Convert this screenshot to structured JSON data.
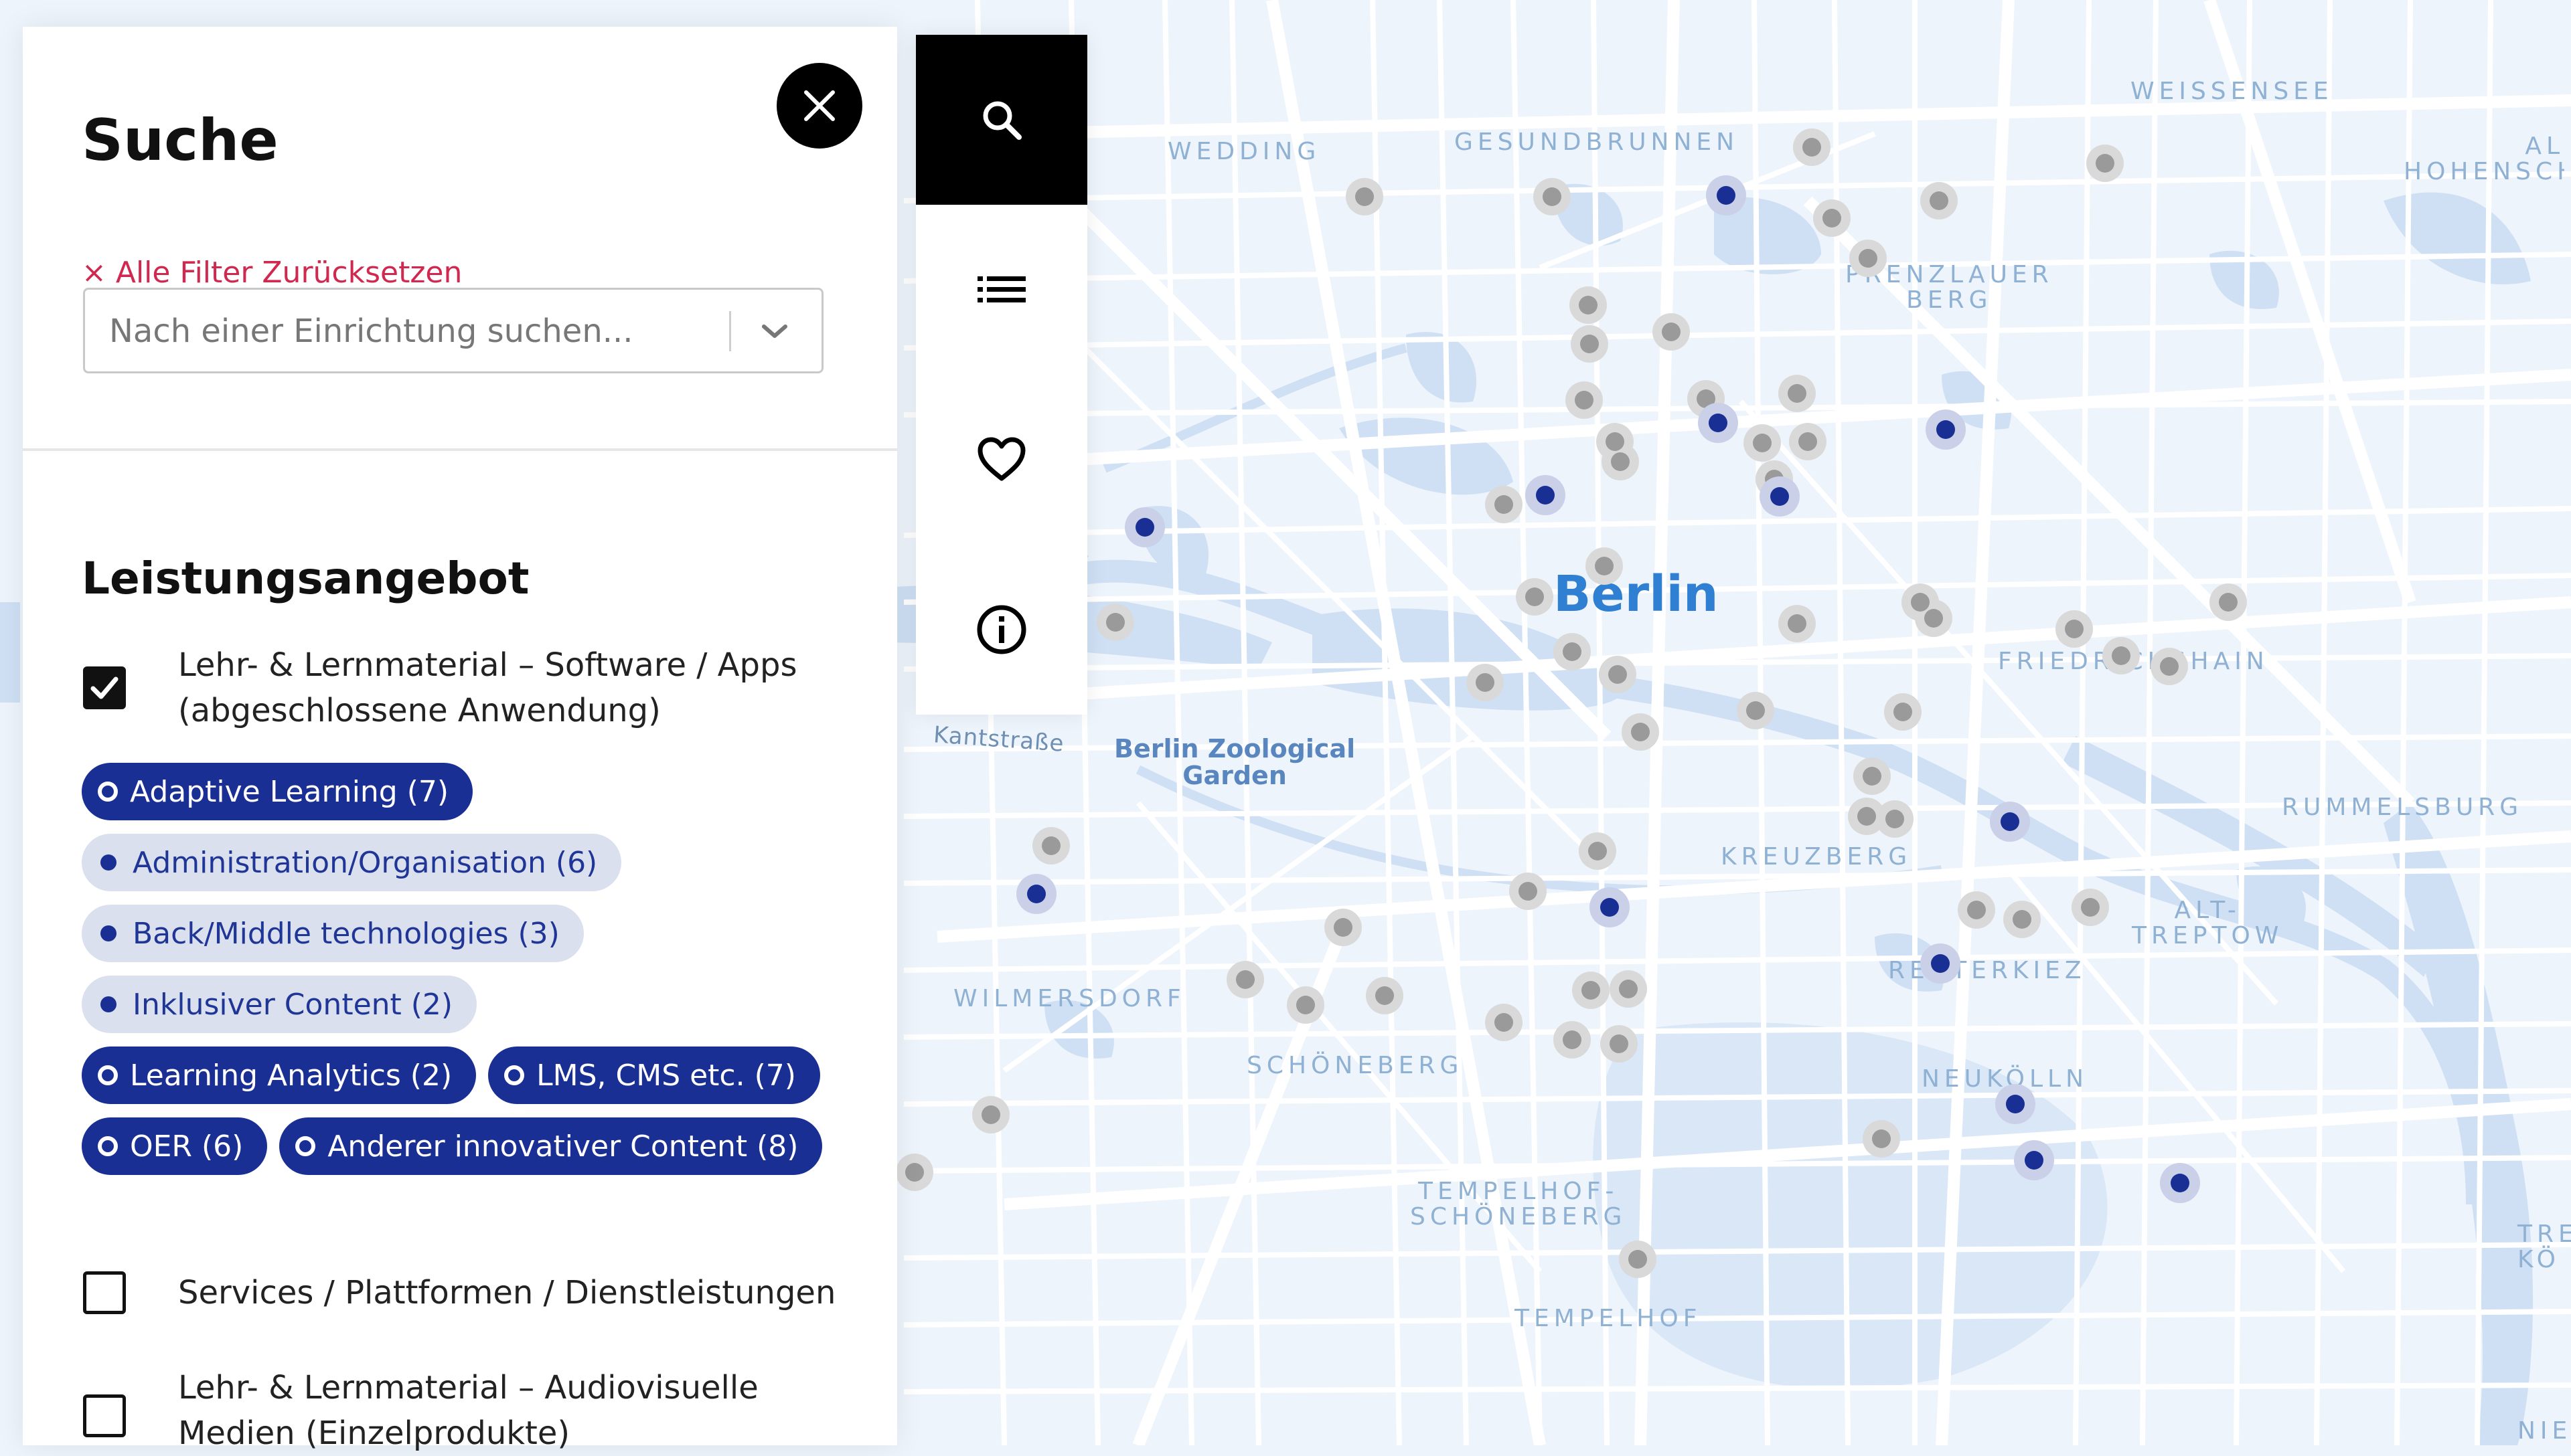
{
  "panel": {
    "title": "Suche",
    "reset_label": "× Alle Filter Zurücksetzen",
    "search": {
      "placeholder": "Nach einer Einrichtung suchen...",
      "value": ""
    },
    "section_title": "Leistungsangebot",
    "categories": [
      {
        "label": "Lehr- & Lernmaterial – Software / Apps (abgeschlossene Anwendung)",
        "checked": true
      },
      {
        "label": "Services / Plattformen / Dienstleistungen",
        "checked": false
      },
      {
        "label": "Lehr- & Lernmaterial – Audiovisuelle Medien (Einzelprodukte)",
        "checked": false
      }
    ],
    "chips": [
      {
        "label": "Adaptive Learning (7)",
        "active": true
      },
      {
        "label": "Administration/Organisation (6)",
        "active": false
      },
      {
        "label": "Back/Middle technologies (3)",
        "active": false
      },
      {
        "label": "Inklusiver Content (2)",
        "active": false
      },
      {
        "label": "Learning Analytics (2)",
        "active": true
      },
      {
        "label": "LMS, CMS etc. (7)",
        "active": true
      },
      {
        "label": "OER (6)",
        "active": true
      },
      {
        "label": "Anderer innovativer Content (8)",
        "active": true
      }
    ]
  },
  "nav": [
    {
      "icon": "search-icon",
      "active": true
    },
    {
      "icon": "list-icon",
      "active": false
    },
    {
      "icon": "heart-icon",
      "active": false
    },
    {
      "icon": "info-icon",
      "active": false
    }
  ],
  "map": {
    "city_label": "Berlin",
    "districts": {
      "wedding": "WEDDING",
      "gesundbrunnen": "GESUNDBRUNNEN",
      "weissensee": "WEISSENSEE",
      "hohenschoenhausen": "AL\nHOHENSCH",
      "prenzlauer_berg": "PRENZLAUER\nBERG",
      "friedrichshain": "FRIEDRICHSHAIN",
      "rummelsburg": "RUMMELSBURG",
      "kreuzberg": "KREUZBERG",
      "alt_treptow": "ALT-\nTREPTOW",
      "reuterkiez": "REUTERKIEZ",
      "neukoelln": "NEUKÖLLN",
      "wilmersdorf": "WILMERSDORF",
      "schoeneberg": "SCHÖNEBERG",
      "tempelhof_schoeneberg": "TEMPELHOF-\nSCHÖNEBERG",
      "tempelhof": "TEMPELHOF",
      "treptow_koepenick": "TRE\nKÖ",
      "niederschoeneweide": "NIE"
    },
    "streets": {
      "kantstrasse": "Kantstraße"
    },
    "pois": {
      "zoo": "Berlin Zoological\nGarden"
    },
    "colors": {
      "land": "#eef4fb",
      "water": "#c8dcf3",
      "road": "#ffffff",
      "marker_match": "#1a2f94",
      "marker_other": "#9a9a9a"
    }
  }
}
